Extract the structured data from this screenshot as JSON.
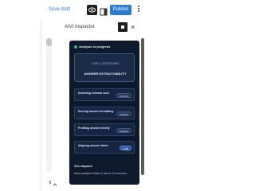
{
  "toolbar": {
    "save_draft": "Save draft",
    "publish": "Publish",
    "accent": "#2d7ad6"
  },
  "panel": {
    "title": "AIVI Inspector",
    "close_glyph": "×"
  },
  "card": {
    "status": "Analysis in progress",
    "live_category_label": "LIVE CATEGORY",
    "live_category_value": "ANSWER EXTRACTABILITY",
    "checks": [
      {
        "label": "Detecting schema cues",
        "status": "STABLE",
        "live": false
      },
      {
        "label": "Scoring answer formatting",
        "status": "STABLE",
        "live": false
      },
      {
        "label": "Profiling answer brevity",
        "status": "STABLE",
        "live": false
      },
      {
        "label": "Aligning answer intent",
        "status": "LIVE",
        "live": true
      }
    ],
    "elapsed": "22s elapsed",
    "finish_note": "Most analyses finish in about 4-5 minutes."
  },
  "icons": {
    "preview": "eye-icon",
    "layout": "sidebar-layout-icon",
    "options": "kebab-menu-icon",
    "pin": "pin-icon",
    "close": "close-icon"
  },
  "colors": {
    "card_bg": "#0d1a2e",
    "status_dot": "#2ec07a"
  }
}
